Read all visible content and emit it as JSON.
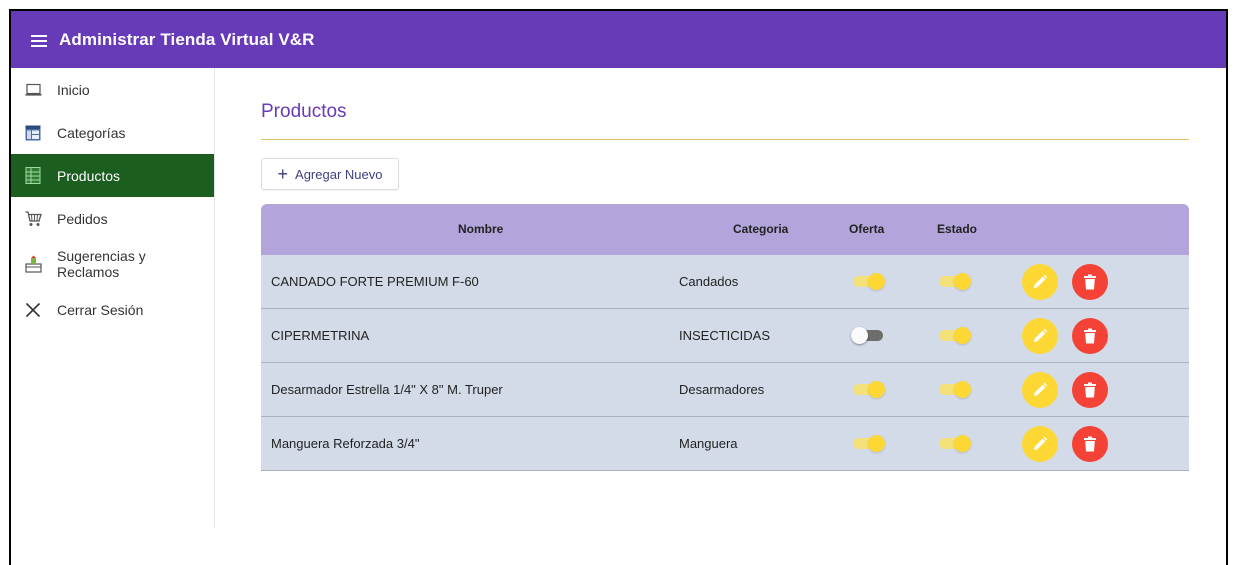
{
  "app": {
    "title": "Administrar Tienda Virtual V&R"
  },
  "sidebar": {
    "items": [
      {
        "label": "Inicio",
        "icon": "laptop-icon",
        "active": false
      },
      {
        "label": "Categorías",
        "icon": "table-icon",
        "active": false
      },
      {
        "label": "Productos",
        "icon": "spreadsheet-icon",
        "active": true
      },
      {
        "label": "Pedidos",
        "icon": "cart-icon",
        "active": false
      },
      {
        "label": "Sugerencias y Reclamos",
        "label_line1": "Sugerencias y",
        "label_line2": "Reclamos",
        "icon": "mailbox-icon",
        "active": false
      },
      {
        "label": "Cerrar Sesión",
        "icon": "close-icon",
        "active": false
      }
    ]
  },
  "main": {
    "title": "Productos",
    "add_button_label": "Agregar Nuevo"
  },
  "table": {
    "headers": {
      "name": "Nombre",
      "category": "Categoria",
      "offer": "Oferta",
      "status": "Estado"
    },
    "rows": [
      {
        "name": "CANDADO FORTE PREMIUM F-60",
        "category": "Candados",
        "offer": true,
        "status": true
      },
      {
        "name": "CIPERMETRINA",
        "category": "INSECTICIDAS",
        "offer": false,
        "status": true
      },
      {
        "name": "Desarmador Estrella 1/4\" X 8\" M. Truper",
        "category": "Desarmadores",
        "offer": true,
        "status": true
      },
      {
        "name": "Manguera Reforzada 3/4\"",
        "category": "Manguera",
        "offer": true,
        "status": true
      }
    ]
  },
  "colors": {
    "topbar": "#673ab7",
    "active_nav": "#1b5e20",
    "table_header": "#b3a4dc",
    "table_row": "#d3dbe8",
    "edit_button": "#fdd835",
    "delete_button": "#f44336"
  }
}
